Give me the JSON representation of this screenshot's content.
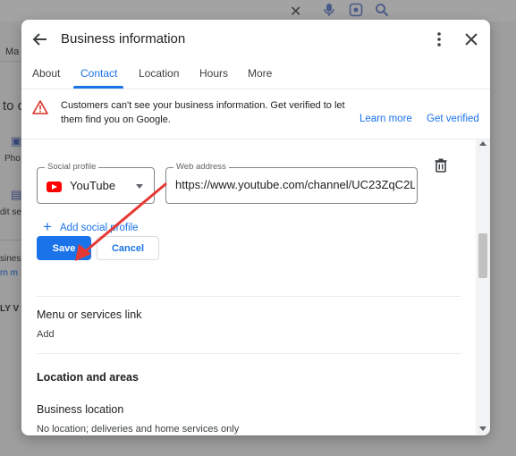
{
  "background": {
    "partial_texts": [
      "Ma",
      "to c",
      "Pho",
      "dit se",
      "sines",
      "rn m",
      "LY V"
    ]
  },
  "dialog": {
    "title": "Business information",
    "tabs": [
      {
        "label": "About"
      },
      {
        "label": "Contact"
      },
      {
        "label": "Location"
      },
      {
        "label": "Hours"
      },
      {
        "label": "More"
      }
    ],
    "active_tab": "Contact"
  },
  "banner": {
    "text": "Customers can't see your business information. Get verified to let them find you on Google.",
    "learn_more": "Learn more",
    "get_verified": "Get verified"
  },
  "social": {
    "profile_label": "Social profile",
    "profile_value": "YouTube",
    "web_label": "Web address",
    "web_value": "https://www.youtube.com/channel/UC23ZqC2L'",
    "add_label": "Add social profile"
  },
  "actions": {
    "save": "Save",
    "cancel": "Cancel"
  },
  "sections": {
    "menu_title": "Menu or services link",
    "menu_add": "Add",
    "location_title": "Location and areas",
    "business_location_title": "Business location",
    "business_location_value": "No location; deliveries and home services only"
  },
  "colors": {
    "accent": "#1a73e8",
    "warning": "#d93025",
    "annotation": "#e53935",
    "youtube": "#ff0000"
  }
}
